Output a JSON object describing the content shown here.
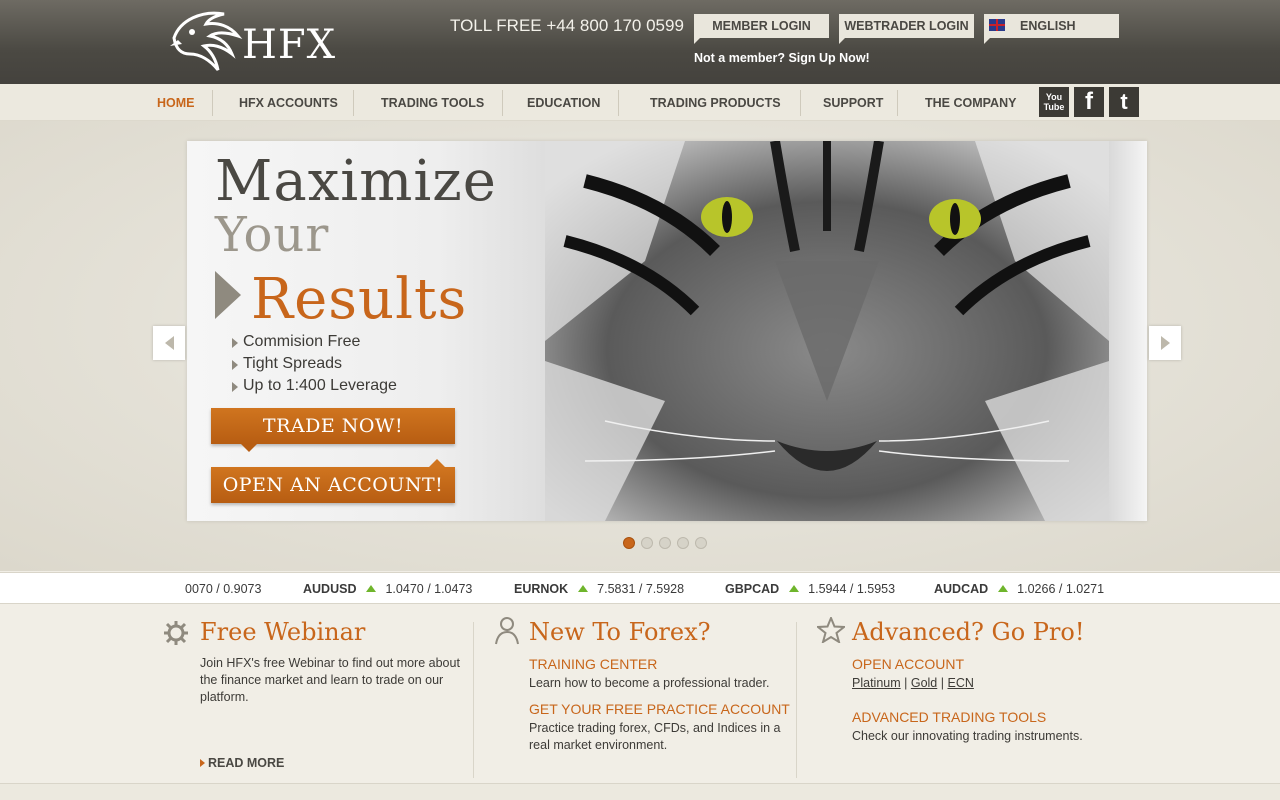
{
  "header": {
    "logo_text": "HFX",
    "toll_free": "TOLL FREE +44 800 170 0599",
    "member_login": "MEMBER LOGIN",
    "webtrader_login": "WEBTRADER LOGIN",
    "language": "ENGLISH",
    "signup": "Not a member? Sign Up Now!"
  },
  "nav": {
    "items": [
      "HOME",
      "HFX ACCOUNTS",
      "TRADING TOOLS",
      "EDUCATION",
      "TRADING PRODUCTS",
      "SUPPORT",
      "THE COMPANY"
    ],
    "social": [
      "You Tube",
      "f",
      "t"
    ]
  },
  "hero": {
    "line1": "Maximize",
    "line2": "Your",
    "line3": "Results",
    "bullets": [
      "Commision Free",
      "Tight Spreads",
      "Up to 1:400 Leverage"
    ],
    "cta_trade": "TRADE NOW!",
    "cta_account": "OPEN AN ACCOUNT!",
    "slide_count": 5,
    "active_slide": 1
  },
  "ticker": [
    {
      "symbol": "",
      "prices": "0070 / 0.9073"
    },
    {
      "symbol": "AUDUSD",
      "prices": "1.0470 / 1.0473"
    },
    {
      "symbol": "EURNOK",
      "prices": "7.5831 / 7.5928"
    },
    {
      "symbol": "GBPCAD",
      "prices": "1.5944 / 1.5953"
    },
    {
      "symbol": "AUDCAD",
      "prices": "1.0266 / 1.0271"
    }
  ],
  "webinar": {
    "title": "Free Webinar",
    "text": "Join HFX's free Webinar to find out more about the finance market and learn to trade on our platform.",
    "read_more": "READ MORE"
  },
  "new_to_forex": {
    "title": "New To Forex?",
    "training_head": "TRAINING CENTER",
    "training_text": "Learn how to become a professional trader.",
    "practice_head": "GET YOUR FREE PRACTICE ACCOUNT",
    "practice_text": "Practice trading forex, CFDs, and Indices in a real market environment."
  },
  "advanced": {
    "title": "Advanced? Go Pro!",
    "open_head": "OPEN ACCOUNT",
    "platinum": "Platinum",
    "gold": "Gold",
    "ecn": "ECN",
    "sep": "|",
    "tools_head": "ADVANCED TRADING TOOLS",
    "tools_text": "Check our innovating trading instruments."
  },
  "colors": {
    "accent": "#c8661b",
    "dark": "#4b4943",
    "up": "#6fb52c"
  }
}
